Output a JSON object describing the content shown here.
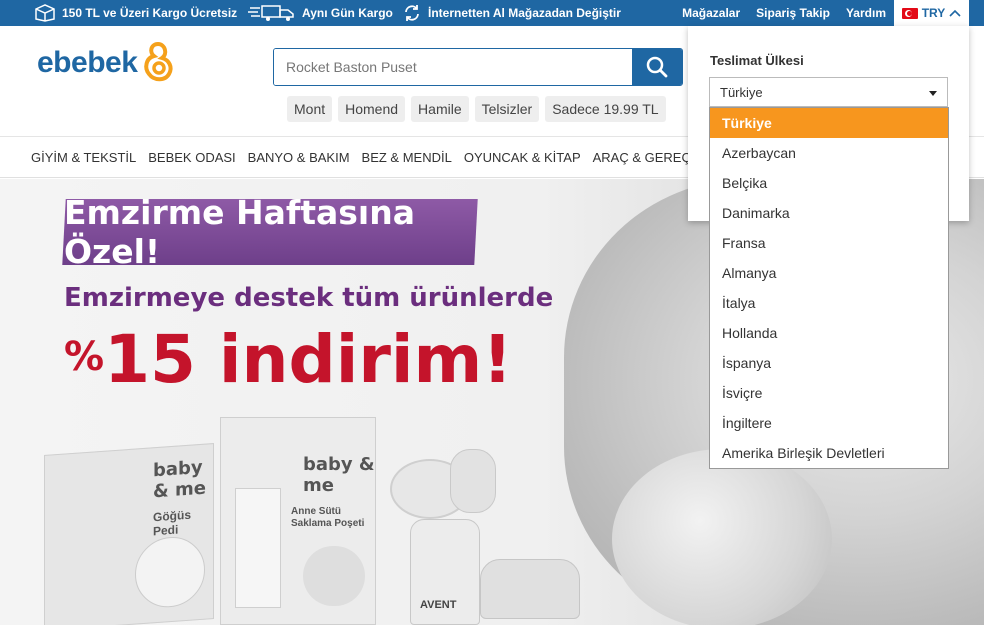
{
  "topbar": {
    "promo_shipping": "150 TL ve Üzeri Kargo Ücretsiz",
    "promo_sameday": "Aynı Gün Kargo",
    "promo_exchange": "İnternetten Al Mağazadan Değiştir",
    "links": [
      "Mağazalar",
      "Sipariş Takip",
      "Yardım"
    ],
    "currency": "TRY",
    "bg_color": "#1f67a3"
  },
  "header": {
    "logo_text": "ebebek",
    "search_placeholder": "Rocket Baston Puset",
    "quick_tags": [
      "Mont",
      "Homend",
      "Hamile",
      "Telsizler",
      "Sadece 19.99 TL"
    ]
  },
  "nav": {
    "items": [
      "GİYİM & TEKSTİL",
      "BEBEK ODASI",
      "BANYO & BAKIM",
      "BEZ & MENDİL",
      "OYUNCAK & KİTAP",
      "ARAÇ & GEREÇ"
    ]
  },
  "banner": {
    "badge": "Emzirme Haftasına Özel!",
    "line2": "Emzirmeye destek tüm ürünlerde",
    "percent": "%",
    "discount": "15 indirim!",
    "product1_brand": "baby & me",
    "product1_name": "Göğüs Pedi",
    "product2_brand": "baby & me",
    "product2_name": "Anne Sütü Saklama Poşeti",
    "product3_name": "AVENT"
  },
  "country_selector": {
    "title": "Teslimat Ülkesi",
    "selected": "Türkiye",
    "options": [
      "Türkiye",
      "Azerbaycan",
      "Belçika",
      "Danimarka",
      "Fransa",
      "Almanya",
      "İtalya",
      "Hollanda",
      "İspanya",
      "İsviçre",
      "İngiltere",
      "Amerika Birleşik Devletleri"
    ],
    "highlight_color": "#f7961e"
  }
}
